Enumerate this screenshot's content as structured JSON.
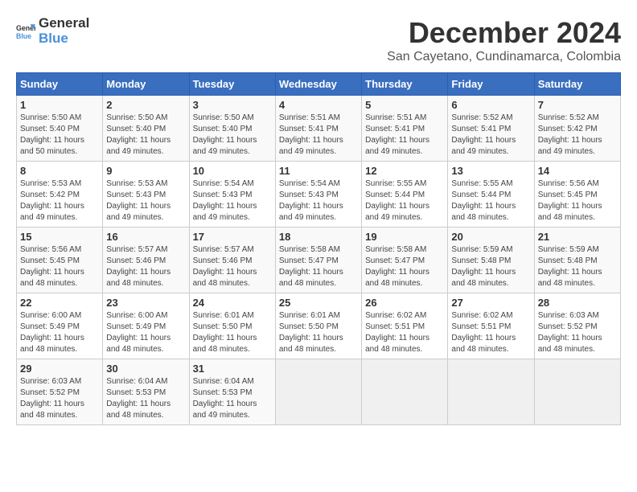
{
  "logo": {
    "general": "General",
    "blue": "Blue"
  },
  "title": "December 2024",
  "subtitle": "San Cayetano, Cundinamarca, Colombia",
  "days_header": [
    "Sunday",
    "Monday",
    "Tuesday",
    "Wednesday",
    "Thursday",
    "Friday",
    "Saturday"
  ],
  "weeks": [
    [
      {
        "day": "1",
        "sunrise": "5:50 AM",
        "sunset": "5:40 PM",
        "daylight": "11 hours and 50 minutes."
      },
      {
        "day": "2",
        "sunrise": "5:50 AM",
        "sunset": "5:40 PM",
        "daylight": "11 hours and 49 minutes."
      },
      {
        "day": "3",
        "sunrise": "5:50 AM",
        "sunset": "5:40 PM",
        "daylight": "11 hours and 49 minutes."
      },
      {
        "day": "4",
        "sunrise": "5:51 AM",
        "sunset": "5:41 PM",
        "daylight": "11 hours and 49 minutes."
      },
      {
        "day": "5",
        "sunrise": "5:51 AM",
        "sunset": "5:41 PM",
        "daylight": "11 hours and 49 minutes."
      },
      {
        "day": "6",
        "sunrise": "5:52 AM",
        "sunset": "5:41 PM",
        "daylight": "11 hours and 49 minutes."
      },
      {
        "day": "7",
        "sunrise": "5:52 AM",
        "sunset": "5:42 PM",
        "daylight": "11 hours and 49 minutes."
      }
    ],
    [
      {
        "day": "8",
        "sunrise": "5:53 AM",
        "sunset": "5:42 PM",
        "daylight": "11 hours and 49 minutes."
      },
      {
        "day": "9",
        "sunrise": "5:53 AM",
        "sunset": "5:43 PM",
        "daylight": "11 hours and 49 minutes."
      },
      {
        "day": "10",
        "sunrise": "5:54 AM",
        "sunset": "5:43 PM",
        "daylight": "11 hours and 49 minutes."
      },
      {
        "day": "11",
        "sunrise": "5:54 AM",
        "sunset": "5:43 PM",
        "daylight": "11 hours and 49 minutes."
      },
      {
        "day": "12",
        "sunrise": "5:55 AM",
        "sunset": "5:44 PM",
        "daylight": "11 hours and 49 minutes."
      },
      {
        "day": "13",
        "sunrise": "5:55 AM",
        "sunset": "5:44 PM",
        "daylight": "11 hours and 48 minutes."
      },
      {
        "day": "14",
        "sunrise": "5:56 AM",
        "sunset": "5:45 PM",
        "daylight": "11 hours and 48 minutes."
      }
    ],
    [
      {
        "day": "15",
        "sunrise": "5:56 AM",
        "sunset": "5:45 PM",
        "daylight": "11 hours and 48 minutes."
      },
      {
        "day": "16",
        "sunrise": "5:57 AM",
        "sunset": "5:46 PM",
        "daylight": "11 hours and 48 minutes."
      },
      {
        "day": "17",
        "sunrise": "5:57 AM",
        "sunset": "5:46 PM",
        "daylight": "11 hours and 48 minutes."
      },
      {
        "day": "18",
        "sunrise": "5:58 AM",
        "sunset": "5:47 PM",
        "daylight": "11 hours and 48 minutes."
      },
      {
        "day": "19",
        "sunrise": "5:58 AM",
        "sunset": "5:47 PM",
        "daylight": "11 hours and 48 minutes."
      },
      {
        "day": "20",
        "sunrise": "5:59 AM",
        "sunset": "5:48 PM",
        "daylight": "11 hours and 48 minutes."
      },
      {
        "day": "21",
        "sunrise": "5:59 AM",
        "sunset": "5:48 PM",
        "daylight": "11 hours and 48 minutes."
      }
    ],
    [
      {
        "day": "22",
        "sunrise": "6:00 AM",
        "sunset": "5:49 PM",
        "daylight": "11 hours and 48 minutes."
      },
      {
        "day": "23",
        "sunrise": "6:00 AM",
        "sunset": "5:49 PM",
        "daylight": "11 hours and 48 minutes."
      },
      {
        "day": "24",
        "sunrise": "6:01 AM",
        "sunset": "5:50 PM",
        "daylight": "11 hours and 48 minutes."
      },
      {
        "day": "25",
        "sunrise": "6:01 AM",
        "sunset": "5:50 PM",
        "daylight": "11 hours and 48 minutes."
      },
      {
        "day": "26",
        "sunrise": "6:02 AM",
        "sunset": "5:51 PM",
        "daylight": "11 hours and 48 minutes."
      },
      {
        "day": "27",
        "sunrise": "6:02 AM",
        "sunset": "5:51 PM",
        "daylight": "11 hours and 48 minutes."
      },
      {
        "day": "28",
        "sunrise": "6:03 AM",
        "sunset": "5:52 PM",
        "daylight": "11 hours and 48 minutes."
      }
    ],
    [
      {
        "day": "29",
        "sunrise": "6:03 AM",
        "sunset": "5:52 PM",
        "daylight": "11 hours and 48 minutes."
      },
      {
        "day": "30",
        "sunrise": "6:04 AM",
        "sunset": "5:53 PM",
        "daylight": "11 hours and 48 minutes."
      },
      {
        "day": "31",
        "sunrise": "6:04 AM",
        "sunset": "5:53 PM",
        "daylight": "11 hours and 49 minutes."
      },
      null,
      null,
      null,
      null
    ]
  ]
}
